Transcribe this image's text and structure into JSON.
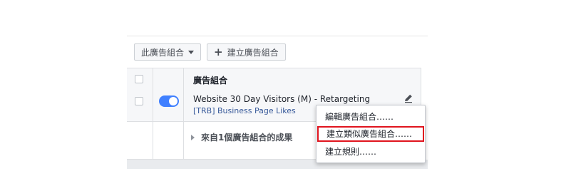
{
  "toolbar": {
    "adset_dropdown_label": "此廣告組合",
    "create_adset_label": "建立廣告組合"
  },
  "table": {
    "header_title": "廣告組合",
    "row": {
      "name": "Website 30 Day Visitors (M) - Retargeting",
      "page": "[TRB] Business Page Likes",
      "toggle_state": "on"
    },
    "results_label": "來自1個廣告組合的成果"
  },
  "context_menu": {
    "items": [
      "編輯廣告組合……",
      "建立類似廣告組合……",
      "建立規則……"
    ],
    "highlighted_index": 1
  },
  "colors": {
    "toggle_on": "#4080ff",
    "highlight_border": "#e0141e",
    "link": "#365899"
  }
}
